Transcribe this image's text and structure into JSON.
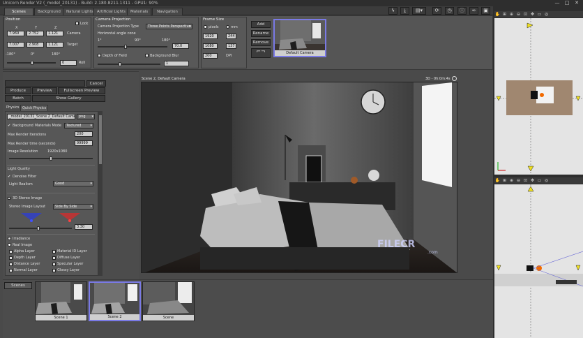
{
  "window": {
    "title": "Unicorn Render V2 (_model_20131) - Build: 2.180.8211.1311 - GPU1: 90%",
    "min": "—",
    "max": "□",
    "close": "✕"
  },
  "tabs": [
    "Scenes",
    "Background",
    "Natural Lights",
    "Artificial Lights",
    "Materials",
    "Navigation"
  ],
  "toolbar_icons": [
    "lightning-icon",
    "download-icon",
    "layout-icon",
    "refresh-icon",
    "history-icon",
    "info-icon",
    "link-icon",
    "picture-icon",
    "help-icon"
  ],
  "position": {
    "title": "Position",
    "lock_label": "Lock",
    "headers": [
      "X",
      "Y",
      "Z"
    ],
    "camera_label": "Camera",
    "target_label": "Target",
    "camera": [
      "7.969",
      "2.752",
      "1.121"
    ],
    "target": [
      "7.007",
      "2.908",
      "1.121"
    ],
    "angle_ticks": [
      "-180°",
      "0°",
      "180°"
    ],
    "roll_value": "0",
    "roll_label": "Roll"
  },
  "projection": {
    "title": "Camera Projection",
    "type_label": "Camera Projection Type",
    "type_value": "Three Points Perspective",
    "angle_label": "Horizontal angle cone",
    "ticks": [
      "1°",
      "90°",
      "180°"
    ],
    "angle_value": "70.0",
    "dof_label": "Depth of Field",
    "blur_label": "Background Blur",
    "blur_value": "1"
  },
  "frame": {
    "title": "Frame Size",
    "pixels_label": "pixels",
    "mm_label": "mm",
    "width": "1920",
    "width_mm": "244",
    "height": "1080",
    "height_mm": "137",
    "dpi": "200",
    "dpi_label": "DPI"
  },
  "camera_buttons": {
    "add": "Add",
    "rename": "Rename",
    "remove": "Remove"
  },
  "camera_thumb_caption": "Default Camera",
  "render": {
    "cancel": "Cancel",
    "produce": "Produce",
    "preview": "Preview",
    "fullscreen": "Fullscreen Preview",
    "batch": "Batch",
    "show_gallery": "Show Gallery"
  },
  "settings": {
    "tabs": [
      "Physics",
      "Quick Physics"
    ],
    "filename": "_model_20131_Scene 2_Default Camera",
    "format": "png",
    "background_label": "Background",
    "materials_mode_label": "Materials Mode",
    "materials_mode": "Textured",
    "max_iter_label": "Max Render Iterations",
    "max_iter": "200",
    "max_time_label": "Max Render time (seconds)",
    "max_time": "99999",
    "resolution_label": "Image Resolution",
    "resolution": "1920x1080",
    "light_quality_label": "Light Quality",
    "denoiser_label": "Denoise Filter",
    "light_realism_label": "Light Realism",
    "light_realism": "Good",
    "stereo_label": "3D Stereo Image",
    "stereo_layout_label": "Stereo Image Layout",
    "stereo_layout": "Side By Side",
    "stereo_value": "3.30",
    "irradiance_label": "Irradiance",
    "real_image_label": "Real Image",
    "layers_left": [
      "Alpha Layer",
      "Depth Layer",
      "Distance Layer",
      "Normal Layer"
    ],
    "layers_right": [
      "Material ID Layer",
      "Diffuse Layer",
      "Specular Layer",
      "Glossy Layer"
    ]
  },
  "viewport": {
    "caption": "Scene 2, Default Camera",
    "progress": "3D - 0h:0m:4s",
    "watermark": "FILECR",
    "watermark_sub": ".com"
  },
  "scenes": {
    "label": "Scenes",
    "items": [
      "Scene 1",
      "Scene 2",
      "Scene"
    ]
  },
  "colors": {
    "accent": "#6b6bd6",
    "ui_bg": "#4a4a4a",
    "panel": "#555555"
  }
}
